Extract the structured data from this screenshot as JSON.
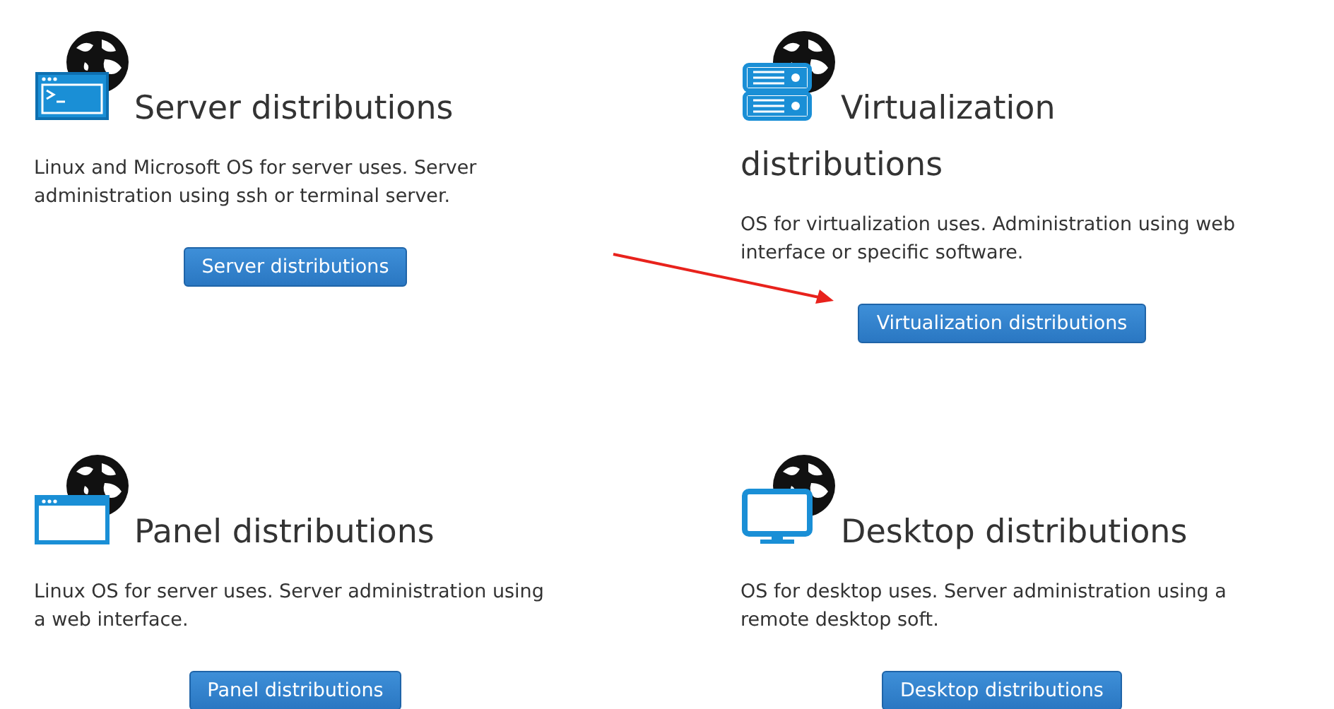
{
  "sections": [
    {
      "kind": "terminal",
      "title": "Server distributions",
      "description": "Linux and Microsoft OS for server uses. Server administration using ssh or terminal server.",
      "button": "Server distributions"
    },
    {
      "kind": "server",
      "title": "Virtualization distributions",
      "description": "OS for virtualization uses. Administration using web interface or specific software.",
      "button": "Virtualization distributions"
    },
    {
      "kind": "window",
      "title": "Panel distributions",
      "description": "Linux OS for server uses. Server administration using a web interface.",
      "button": "Panel distributions"
    },
    {
      "kind": "monitor",
      "title": "Desktop distributions",
      "description": "OS for desktop uses. Server administration using a remote desktop soft.",
      "button": "Desktop distributions"
    }
  ]
}
